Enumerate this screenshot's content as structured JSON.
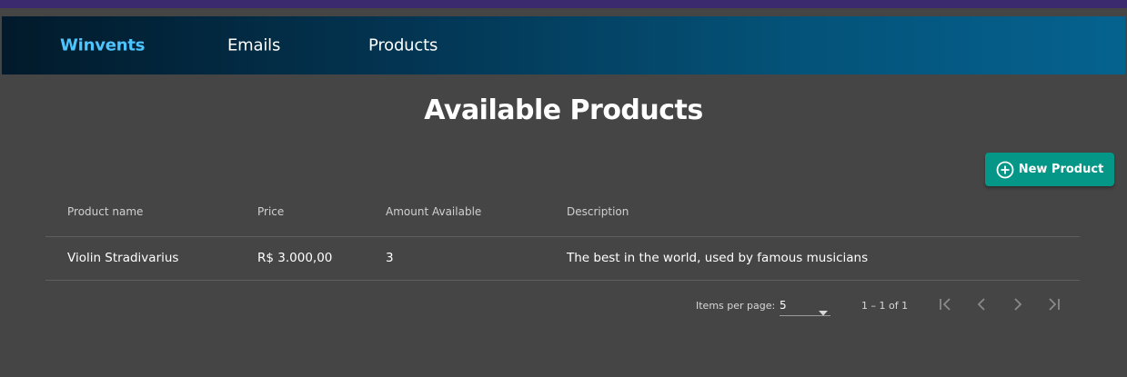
{
  "nav": {
    "brand": "Winvents",
    "links": [
      "Emails",
      "Products"
    ]
  },
  "page": {
    "title": "Available Products",
    "new_button_label": "New Product"
  },
  "table": {
    "columns": [
      "Product name",
      "Price",
      "Amount Available",
      "Description"
    ],
    "rows": [
      {
        "name": "Violin Stradivarius",
        "price": "R$ 3.000,00",
        "amount": "3",
        "description": "The best in the world, used by famous musicians"
      }
    ]
  },
  "paginator": {
    "items_per_page_label": "Items per page:",
    "page_size": "5",
    "range_label": "1 – 1 of 1"
  },
  "colors": {
    "accent": "#049686",
    "brand": "#4ec5ff",
    "background": "#454545"
  },
  "icons": {
    "new": "add-circle-icon",
    "first": "first-page-icon",
    "prev": "chevron-left-icon",
    "next": "chevron-right-icon",
    "last": "last-page-icon"
  }
}
